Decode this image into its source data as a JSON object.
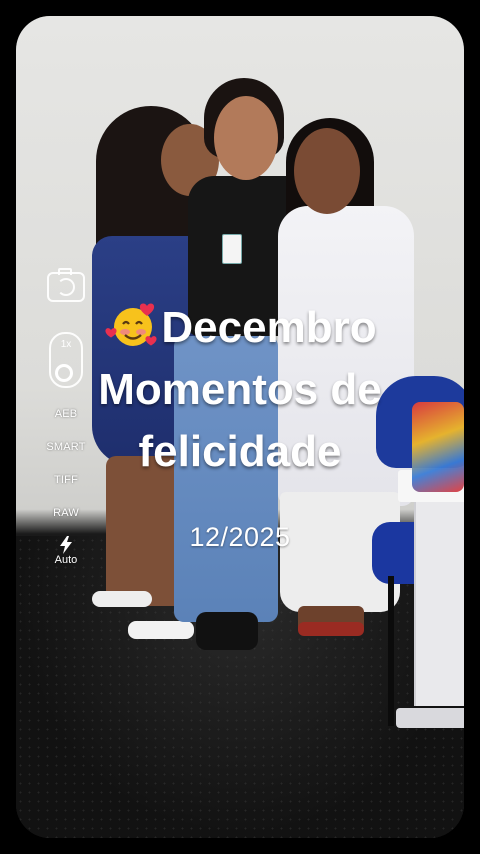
{
  "camera_controls": {
    "zoom_label": "1x",
    "options": [
      "AEB",
      "SMART",
      "TIFF",
      "RAW"
    ],
    "flash_label": "Auto"
  },
  "overlay": {
    "line1": "Decembro",
    "line2": "Momentos de",
    "line3": "felicidade",
    "date": "12/2025",
    "emoji_icon": "smiling-face-with-hearts-icon"
  },
  "colors": {
    "background": "#000000",
    "overlay_text": "#ffffff"
  }
}
